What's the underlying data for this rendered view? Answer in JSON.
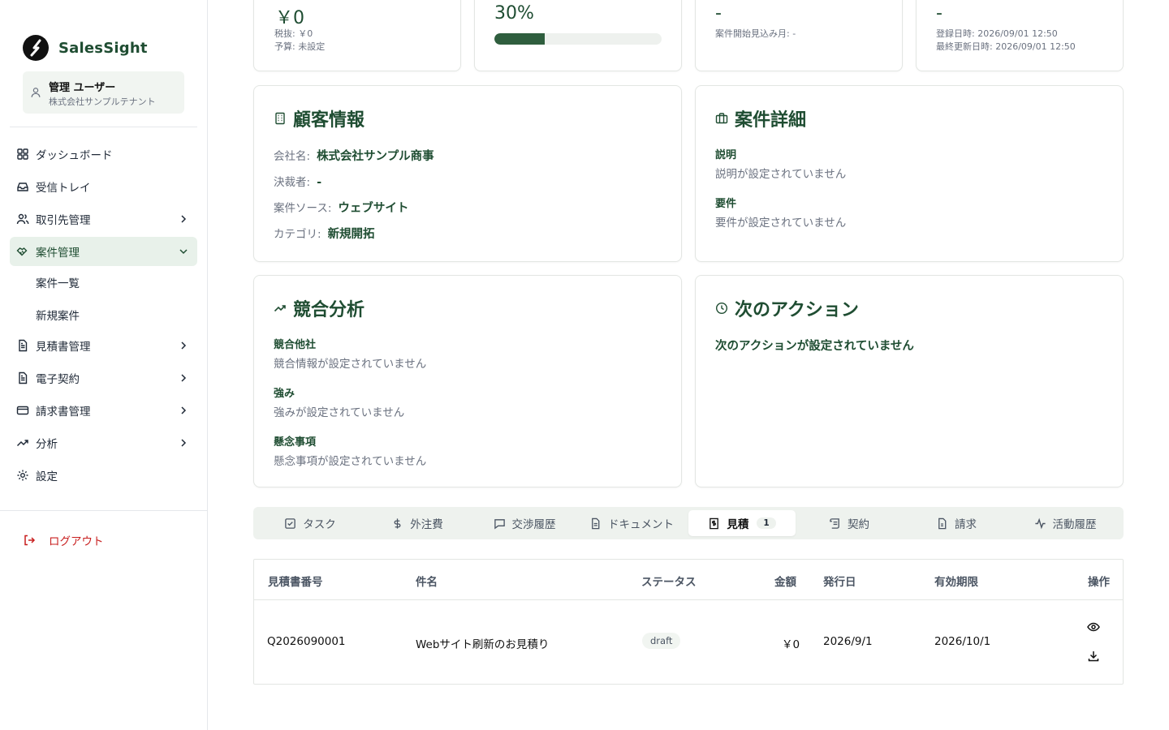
{
  "app": {
    "name": "SalesSight",
    "user": {
      "name": "管理 ユーザー",
      "tenant": "株式会社サンプルテナント"
    }
  },
  "sidebar": {
    "items": [
      {
        "label": "ダッシュボード"
      },
      {
        "label": "受信トレイ"
      },
      {
        "label": "取引先管理"
      },
      {
        "label": "案件管理"
      },
      {
        "label": "見積書管理"
      },
      {
        "label": "電子契約"
      },
      {
        "label": "請求書管理"
      },
      {
        "label": "分析"
      },
      {
        "label": "設定"
      }
    ],
    "sub_items": [
      {
        "label": "案件一覧"
      },
      {
        "label": "新規案件"
      }
    ],
    "logout": "ログアウト"
  },
  "summary": {
    "amount": {
      "value": "￥0",
      "tax_excluded": "税抜: ￥0",
      "budget": "予算: 未設定"
    },
    "probability": {
      "value": "30%",
      "percent": 30
    },
    "schedule": {
      "value": "-",
      "start_month": "案件開始見込み月: -"
    },
    "dates": {
      "value": "-",
      "created": "登録日時: 2026/09/01 12:50",
      "updated": "最終更新日時: 2026/09/01 12:50"
    }
  },
  "customer": {
    "title": "顧客情報",
    "company_key": "会社名:",
    "company": "株式会社サンプル商事",
    "decision_key": "決裁者:",
    "decision": "-",
    "source_key": "案件ソース:",
    "source": "ウェブサイト",
    "category_key": "カテゴリ:",
    "category": "新規開拓"
  },
  "details": {
    "title": "案件詳細",
    "desc_label": "説明",
    "desc_value": "説明が設定されていません",
    "req_label": "要件",
    "req_value": "要件が設定されていません"
  },
  "competition": {
    "title": "競合分析",
    "rivals_label": "競合他社",
    "rivals_value": "競合情報が設定されていません",
    "strength_label": "強み",
    "strength_value": "強みが設定されていません",
    "concern_label": "懸念事項",
    "concern_value": "懸念事項が設定されていません"
  },
  "next_action": {
    "title": "次のアクション",
    "empty": "次のアクションが設定されていません"
  },
  "tabs": [
    {
      "label": "タスク"
    },
    {
      "label": "外注費"
    },
    {
      "label": "交渉履歴"
    },
    {
      "label": "ドキュメント"
    },
    {
      "label": "見積",
      "badge": "1"
    },
    {
      "label": "契約"
    },
    {
      "label": "請求"
    },
    {
      "label": "活動履歴"
    }
  ],
  "quotes_table": {
    "headers": [
      "見積書番号",
      "件名",
      "ステータス",
      "金額",
      "発行日",
      "有効期限",
      "操作"
    ],
    "rows": [
      {
        "number": "Q2026090001",
        "subject": "Webサイト刷新のお見積り",
        "status": "draft",
        "amount": "￥0",
        "issued": "2026/9/1",
        "valid_until": "2026/10/1"
      }
    ]
  },
  "colors": {
    "accent": "#1f4d32",
    "progress": "#2f5e3e",
    "danger": "#c81e1e"
  }
}
